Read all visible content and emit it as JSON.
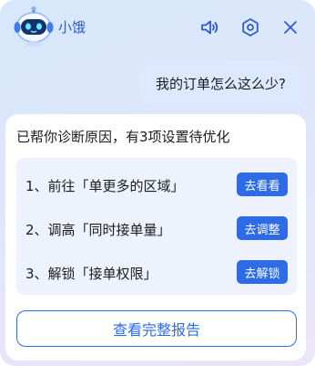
{
  "app": {
    "name": "小饿",
    "accent": "#2e6be6"
  },
  "header": {
    "icons": [
      "speaker-icon",
      "settings-icon",
      "close-icon"
    ]
  },
  "user_message": {
    "text": "我的订单怎么这么少?"
  },
  "reply": {
    "title": "已帮你诊断原因，有3项设置待优化",
    "items": [
      {
        "label": "1、前往「单更多的区域」",
        "button": "去看看"
      },
      {
        "label": "2、调高「同时接单量」",
        "button": "去调整"
      },
      {
        "label": "3、解锁「接单权限」",
        "button": "去解锁"
      }
    ],
    "report_button": "查看完整报告"
  }
}
